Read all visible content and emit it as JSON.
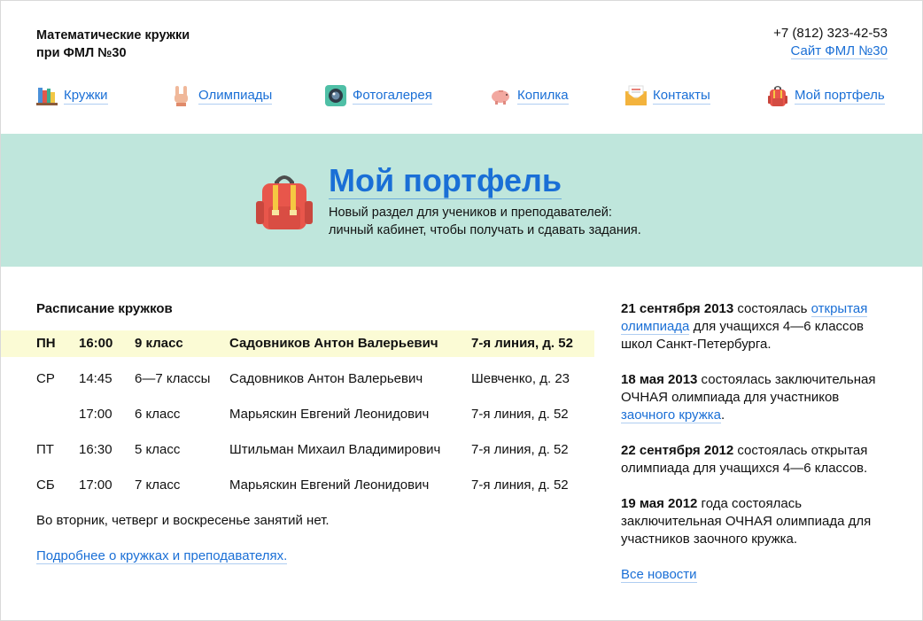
{
  "header": {
    "title_line1": "Математические кружки",
    "title_line2": "при ФМЛ №30",
    "phone": "+7 (812) 323-42-53",
    "site_link": "Сайт ФМЛ №30"
  },
  "nav": [
    {
      "label": "Кружки",
      "icon": "books-icon"
    },
    {
      "label": "Олимпиады",
      "icon": "hand-icon"
    },
    {
      "label": "Фотогалерея",
      "icon": "camera-icon"
    },
    {
      "label": "Копилка",
      "icon": "piggy-bank-icon"
    },
    {
      "label": "Контакты",
      "icon": "envelope-icon"
    },
    {
      "label": "Мой портфель",
      "icon": "backpack-icon"
    }
  ],
  "banner": {
    "title": "Мой портфель",
    "desc_line1": "Новый раздел для учеников и преподавателей:",
    "desc_line2": "личный кабинет, чтобы получать и сдавать задания.",
    "background": "#bfe6dc"
  },
  "schedule": {
    "heading": "Расписание кружков",
    "rows": [
      {
        "day": "ПН",
        "time": "16:00",
        "cls": "9 класс",
        "teacher": "Садовников Антон Валерьевич",
        "addr": "7-я линия, д. 52"
      },
      {
        "day": "СР",
        "time": "14:45",
        "cls": "6—7 классы",
        "teacher": "Садовников Антон Валерьевич",
        "addr": "Шевченко, д. 23"
      },
      {
        "day": "",
        "time": "17:00",
        "cls": "6 класс",
        "teacher": "Марьяскин Евгений Леонидович",
        "addr": "7-я линия, д. 52"
      },
      {
        "day": "ПТ",
        "time": "16:30",
        "cls": "5 класс",
        "teacher": "Штильман Михаил Владимирович",
        "addr": "7-я линия, д. 52"
      },
      {
        "day": "СБ",
        "time": "17:00",
        "cls": "7 класс",
        "teacher": "Марьяскин Евгений Леонидович",
        "addr": "7-я линия, д. 52"
      }
    ],
    "note": "Во вторник, четверг и воскресенье занятий нет.",
    "more_link": "Подробнее о кружках и преподавателях."
  },
  "news": {
    "items": [
      {
        "date": "21 сентября 2013",
        "text1": " состоялась ",
        "link1": "открытая олимпиада",
        "text2": " для учащихся 4—6 классов школ Санкт-Петербурга."
      },
      {
        "date": "18 мая 2013",
        "text1": " состоялась заключительная ОЧНАЯ олимпиада для участников ",
        "link1": "заочного кружка",
        "text2": "."
      },
      {
        "date": "22 сентября 2012",
        "text1": " состоялась открытая олимпиада для учащихся 4—6 классов.",
        "link1": "",
        "text2": ""
      },
      {
        "date": "19 мая 2012",
        "text1": " года состоялась заключительная ОЧНАЯ олимпиада для участников заочного кружка.",
        "link1": "",
        "text2": ""
      }
    ],
    "all_link": "Все новости"
  },
  "colors": {
    "link": "#1a6fd6",
    "highlight_row": "#fbfbd5"
  }
}
